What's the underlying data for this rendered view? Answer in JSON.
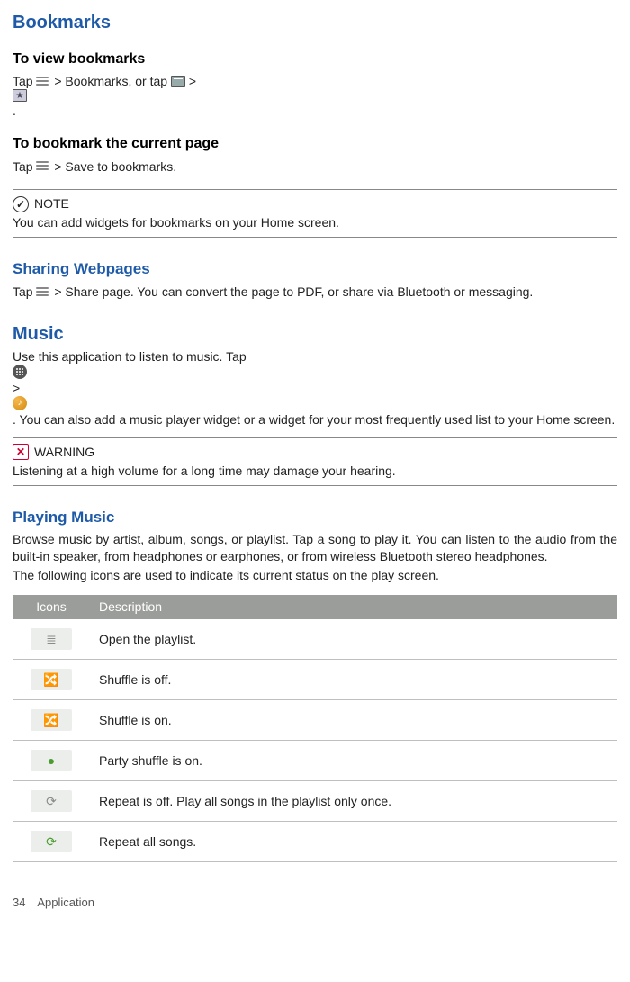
{
  "bookmarks": {
    "heading": "Bookmarks",
    "view": {
      "heading": "To view  bookmarks",
      "tap1": "Tap ",
      "mid": "  > Bookmarks, or tap ",
      "mid2": ">",
      "end": "."
    },
    "add": {
      "heading": "To bookmark the current  page",
      "tap": "Tap ",
      "rest": " > Save to bookmarks."
    },
    "note_label": "NOTE",
    "note_body": "You can add widgets for bookmarks on your Home   screen."
  },
  "sharing": {
    "heading": "Sharing Webpages",
    "tap": "Tap",
    "rest": " > Share page. You can convert the page to PDF, or share via Bluetooth or messaging."
  },
  "music": {
    "heading": "Music",
    "pre": "Use this application to listen to music. Tap ",
    "mid": ">",
    "post": ". You can also add a music player widget or a widget for your most frequently used list to your Home   screen.",
    "warn_label": "WARNING",
    "warn_body": "Listening at a high volume for a long time may damage your  hearing."
  },
  "playing": {
    "heading": "Playing Music",
    "p1": "Browse music by artist, album, songs, or playlist. Tap  a song to play it. You  can listen to the audio from the built-in speaker, from headphones or earphones, or from wireless Bluetooth stereo  headphones.",
    "p2": "The following icons are used to indicate its current status on the play   screen."
  },
  "table": {
    "h_icons": "Icons",
    "h_desc": "Description",
    "rows": [
      {
        "glyph": "≣",
        "cls": "grey",
        "name": "playlist-icon",
        "desc": "Open the playlist."
      },
      {
        "glyph": "🔀",
        "cls": "grey",
        "name": "shuffle-off-icon",
        "desc": "Shuffle is off."
      },
      {
        "glyph": "🔀",
        "cls": "green",
        "name": "shuffle-on-icon",
        "desc": "Shuffle is on."
      },
      {
        "glyph": "●",
        "cls": "green",
        "name": "party-shuffle-icon",
        "desc": "Party shuffle is on."
      },
      {
        "glyph": "⟳",
        "cls": "grey",
        "name": "repeat-off-icon",
        "desc": "Repeat is off. Play all songs in the playlist only  once."
      },
      {
        "glyph": "⟳",
        "cls": "green",
        "name": "repeat-all-icon",
        "desc": "Repeat all songs."
      }
    ]
  },
  "footer": {
    "page": "34",
    "title": "Application"
  }
}
